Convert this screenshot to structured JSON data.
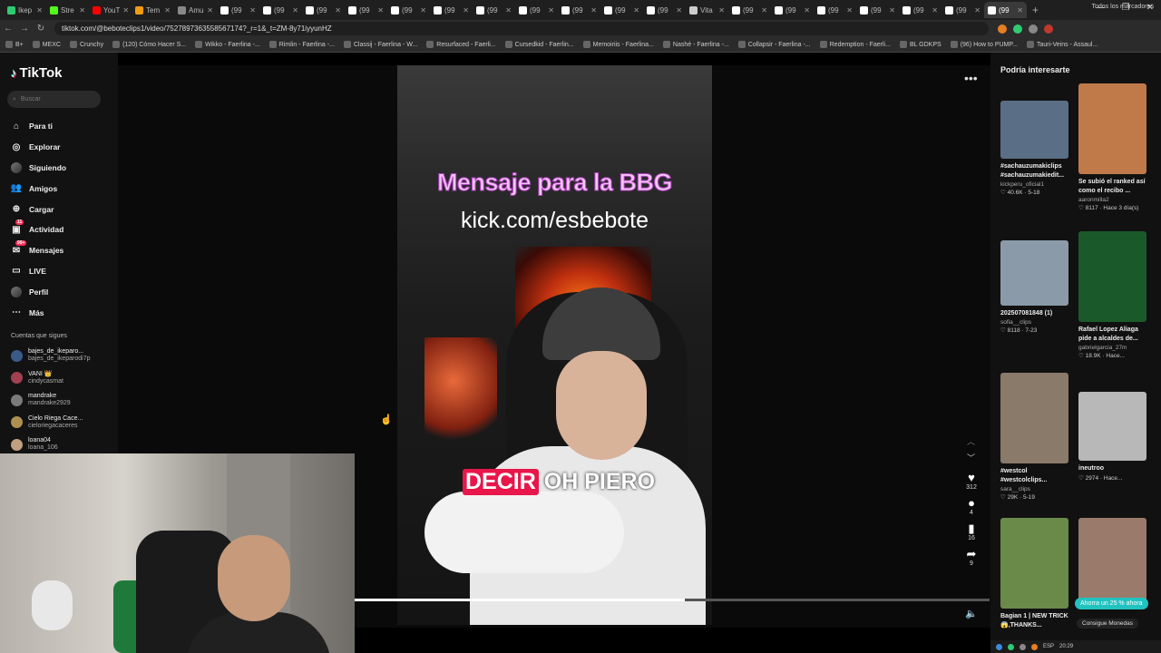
{
  "browser": {
    "tabs": [
      {
        "label": "Ikep",
        "color": "#2ecc71"
      },
      {
        "label": "Stre",
        "color": "#53fc18"
      },
      {
        "label": "YouT",
        "color": "#ff0000"
      },
      {
        "label": "Tem",
        "color": "#f39c12"
      },
      {
        "label": "Amu",
        "color": "#888888"
      },
      {
        "label": "(99",
        "color": "#ffffff"
      },
      {
        "label": "(99",
        "color": "#ffffff"
      },
      {
        "label": "(99",
        "color": "#ffffff"
      },
      {
        "label": "(99",
        "color": "#ffffff"
      },
      {
        "label": "(99",
        "color": "#ffffff"
      },
      {
        "label": "(99",
        "color": "#ffffff"
      },
      {
        "label": "(99",
        "color": "#ffffff"
      },
      {
        "label": "(99",
        "color": "#ffffff"
      },
      {
        "label": "(99",
        "color": "#ffffff"
      },
      {
        "label": "(99",
        "color": "#ffffff"
      },
      {
        "label": "(99",
        "color": "#ffffff"
      },
      {
        "label": "Vita",
        "color": "#cccccc"
      },
      {
        "label": "(99",
        "color": "#ffffff"
      },
      {
        "label": "(99",
        "color": "#ffffff"
      },
      {
        "label": "(99",
        "color": "#ffffff"
      },
      {
        "label": "(99",
        "color": "#ffffff"
      },
      {
        "label": "(99",
        "color": "#ffffff"
      },
      {
        "label": "(99",
        "color": "#ffffff"
      },
      {
        "label": "(99",
        "color": "#ffffff"
      }
    ],
    "url": "tiktok.com/@beboteclips1/video/7527897363558567174?_r=1&_t=ZM-8y71iyyunHZ",
    "bookmarks": [
      "B+",
      "MEXC",
      "Crunchy",
      "(120) Cómo Hacer S...",
      "Wikko - Faerlina -...",
      "Rimlin - Faerlina -...",
      "Classij - Faerlina - W...",
      "Resurfaced - Faerli...",
      "Cursedkid - Faerlin...",
      "Memoiriis - Faerlina...",
      "Nashé - Faerlina -...",
      "Collapsir - Faerlina -...",
      "Redemption - Faerli...",
      "BL GDKPS",
      "(96) How to PUMP...",
      "Tauri-Veins - Assaul..."
    ],
    "bookmarks_all": "Todos los marcadores"
  },
  "sidebar": {
    "logo": "TikTok",
    "search_placeholder": "Buscar",
    "nav": [
      {
        "label": "Para ti",
        "icon": "home-icon",
        "glyph": "⌂"
      },
      {
        "label": "Explorar",
        "icon": "compass-icon",
        "glyph": "◎"
      },
      {
        "label": "Siguiendo",
        "icon": "following-icon",
        "glyph": "●"
      },
      {
        "label": "Amigos",
        "icon": "friends-icon",
        "glyph": "👥"
      },
      {
        "label": "Cargar",
        "icon": "upload-icon",
        "glyph": "⊕"
      },
      {
        "label": "Actividad",
        "icon": "activity-icon",
        "glyph": "▣"
      },
      {
        "label": "Mensajes",
        "icon": "messages-icon",
        "glyph": "✉"
      },
      {
        "label": "LIVE",
        "icon": "live-icon",
        "glyph": "▭"
      },
      {
        "label": "Perfil",
        "icon": "profile-icon",
        "glyph": "●"
      },
      {
        "label": "Más",
        "icon": "more-icon",
        "glyph": "⋯"
      }
    ],
    "following_title": "Cuentas que sigues",
    "following": [
      {
        "name": "bajes_de_ikeparo...",
        "handle": "bajes_de_ikeparodi7p",
        "color": "#3a5a8a"
      },
      {
        "name": "VANI 👑",
        "handle": "cindycasmat",
        "color": "#a04050"
      },
      {
        "name": "mandrake",
        "handle": "mandrake2929",
        "color": "#7a7a7a"
      },
      {
        "name": "Cielo Riega Cace...",
        "handle": "cieloriegacaceres",
        "color": "#b09050"
      },
      {
        "name": "loana04",
        "handle": "loana_106",
        "color": "#c0a080"
      }
    ]
  },
  "video": {
    "title_caption": "Mensaje para la BBG",
    "link_caption": "kick.com/esbebote",
    "subtitle_highlight": "DECIR",
    "subtitle_rest": "OH PIERO",
    "likes": "312",
    "comments": "4",
    "saves": "16",
    "shares": "9",
    "progress": 0.52
  },
  "right_panel": {
    "title": "Podría interesarte",
    "cards": [
      {
        "caption": "#sachauzumakiclips #sachauzumakiedit...",
        "user": "kickperu_oficial1",
        "meta": "♡ 40.6K · 5-18",
        "bg": "#5a6f86",
        "h": 64
      },
      {
        "caption": "Se subió el ranked así como el recibo ...",
        "user": "aaronmilla2",
        "meta": "♡ 8117 · Hace 3 día(s)",
        "bg": "#c07a4a",
        "h": 100
      },
      {
        "caption": "202507081848 (1)",
        "user": "sofia__clips",
        "meta": "♡ 8118 · 7-23",
        "bg": "#8a9aa8",
        "h": 72
      },
      {
        "caption": "Rafael Lopez Aliaga pide a alcaldes de...",
        "user": "gabrielgarcia_27m",
        "meta": "♡ 18.9K · Hace...",
        "bg": "#1a5a2a",
        "h": 100
      },
      {
        "caption": "#westcol #westcolclips...",
        "user": "sara__clips",
        "meta": "♡ 29K · 5-19",
        "bg": "#8a7a6a",
        "h": 100
      },
      {
        "caption": "ineutroo",
        "user": "",
        "meta": "♡ 2974 · Hace...",
        "bg": "#b8b8b8",
        "h": 76
      },
      {
        "caption": "Bagian 1 | NEW TRICK😱,THANKS...",
        "user": "",
        "meta": "",
        "bg": "#6a8a4a",
        "h": 100
      },
      {
        "caption": "",
        "user": "",
        "meta": "",
        "bg": "#9a7a6a",
        "h": 100
      }
    ],
    "promo": "Ahorra un 25 % ahora",
    "coins": "Consigue Monedas"
  },
  "taskbar": {
    "lang": "ESP",
    "time": "20:29"
  }
}
